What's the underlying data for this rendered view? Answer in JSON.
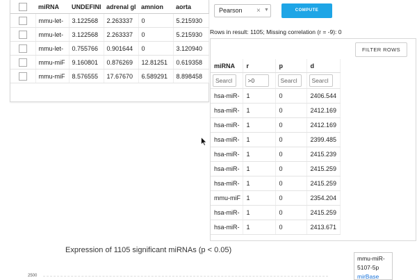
{
  "expression_table": {
    "columns": [
      "",
      "miRNA",
      "UNDEFINI",
      "adrenal gl",
      "amnion",
      "aorta"
    ],
    "rows": [
      {
        "mirna": "mmu-let-",
        "undefined": "3.122568",
        "adrenal": "2.263337",
        "amnion": "0",
        "aorta": "5.215930"
      },
      {
        "mirna": "mmu-let-",
        "undefined": "3.122568",
        "adrenal": "2.263337",
        "amnion": "0",
        "aorta": "5.215930"
      },
      {
        "mirna": "mmu-let-",
        "undefined": "0.755766",
        "adrenal": "0.901644",
        "amnion": "0",
        "aorta": "3.120940"
      },
      {
        "mirna": "mmu-miF",
        "undefined": "9.160801",
        "adrenal": "0.876269",
        "amnion": "12.81251",
        "aorta": "0.619358"
      },
      {
        "mirna": "mmu-miF",
        "undefined": "8.576555",
        "adrenal": "17.67670",
        "amnion": "6.589291",
        "aorta": "8.898458"
      }
    ]
  },
  "controls": {
    "method_selected": "Pearson",
    "clear_symbol": "×",
    "caret_symbol": "▼",
    "compute_label": "COMPUTE"
  },
  "rows_info": "Rows in result: 1105; Missing correlation (r = -9): 0",
  "correlation_table": {
    "filter_button": "FILTER ROWS",
    "columns": [
      "miRNA",
      "r",
      "p",
      "d"
    ],
    "filters": {
      "mirna_placeholder": "Searcl",
      "r_value": ">0",
      "p_placeholder": "Searcl",
      "d_placeholder": "Searcl"
    },
    "rows": [
      {
        "mirna": "hsa-miR-",
        "r": "1",
        "p": "0",
        "d": "2406.544"
      },
      {
        "mirna": "hsa-miR-",
        "r": "1",
        "p": "0",
        "d": "2412.169"
      },
      {
        "mirna": "hsa-miR-",
        "r": "1",
        "p": "0",
        "d": "2412.169"
      },
      {
        "mirna": "hsa-miR-",
        "r": "1",
        "p": "0",
        "d": "2399.485"
      },
      {
        "mirna": "hsa-miR-",
        "r": "1",
        "p": "0",
        "d": "2415.239"
      },
      {
        "mirna": "hsa-miR-",
        "r": "1",
        "p": "0",
        "d": "2415.259"
      },
      {
        "mirna": "hsa-miR-",
        "r": "1",
        "p": "0",
        "d": "2415.259"
      },
      {
        "mirna": "mmu-miF",
        "r": "1",
        "p": "0",
        "d": "2354.204"
      },
      {
        "mirna": "hsa-miR-",
        "r": "1",
        "p": "0",
        "d": "2415.259"
      },
      {
        "mirna": "hsa-miR-",
        "r": "1",
        "p": "0",
        "d": "2413.671"
      }
    ]
  },
  "chart": {
    "title": "Expression of 1105 significant miRNAs (p < 0.05)",
    "y_tick": "2500",
    "legend_items": [
      "mmu-miR-",
      "5107-5p",
      "mirBase"
    ]
  },
  "colors": {
    "compute_button": "#1ea5e6",
    "legend_link": "#1a73d9"
  }
}
